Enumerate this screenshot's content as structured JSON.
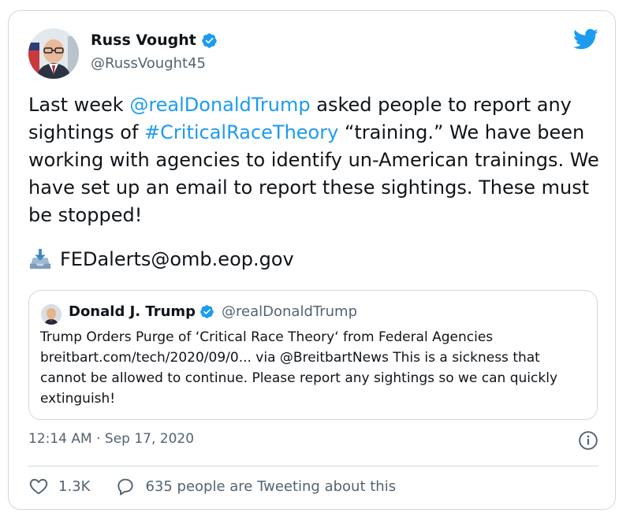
{
  "tweet": {
    "author_name": "Russ Vought",
    "author_handle": "@RussVought45",
    "text_parts": {
      "p1": "Last week ",
      "mention": "@realDonaldTrump",
      "p2": " asked people to report any sightings of ",
      "hashtag": "#CriticalRaceTheory",
      "p3": " “training.” We have been working with agencies to identify un-American trainings. We have set up an email to report these sightings. These must be stopped!"
    },
    "email": "FEDalerts@omb.eop.gov",
    "timestamp": "12:14 AM · Sep 17, 2020",
    "like_count": "1.3K",
    "reply_text": "635 people are Tweeting about this"
  },
  "quoted": {
    "author_name": "Donald J. Trump",
    "author_handle": "@realDonaldTrump",
    "text": "Trump Orders Purge of ‘Critical Race Theory‘ from Federal Agencies breitbart.com/tech/2020/09/0... via @BreitbartNews This is a sickness that cannot be allowed to continue. Please report any sightings so we can quickly extinguish!"
  },
  "colors": {
    "link": "#1d9bf0",
    "text": "#0f1419",
    "muted": "#536471",
    "border": "#cfd9de"
  },
  "icons": [
    "verified-badge-icon",
    "twitter-bird-icon",
    "inbox-tray-icon",
    "info-icon",
    "heart-icon",
    "reply-bubble-icon"
  ]
}
